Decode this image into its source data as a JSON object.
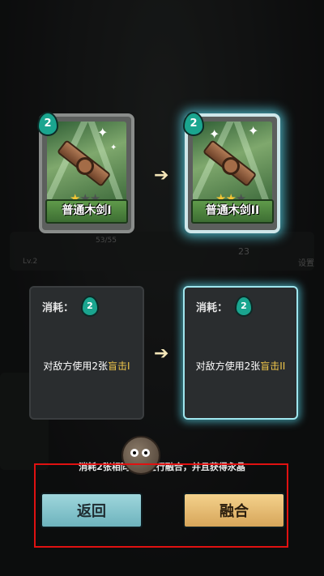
{
  "background": {
    "hp_text": "53/55",
    "level_text": "Lv.2",
    "gold": "23",
    "settings_label": "设置"
  },
  "cards": [
    {
      "cost": "2",
      "name": "普通木剑I",
      "stars": 1,
      "max_stars": 3
    },
    {
      "cost": "2",
      "name": "普通木剑II",
      "stars": 2,
      "max_stars": 3
    }
  ],
  "panels": [
    {
      "cost_label": "消耗：",
      "cost": "2",
      "desc_prefix": "对敌方使用2张",
      "desc_keyword": "盲击I"
    },
    {
      "cost_label": "消耗：",
      "cost": "2",
      "desc_prefix": "对敌方使用2张",
      "desc_keyword": "盲击II"
    }
  ],
  "hint": "消耗2张相同卡牌进行融合，并且获得永晶",
  "buttons": {
    "back": "返回",
    "fuse": "融合"
  },
  "colors": {
    "highlight": "#f2c84b",
    "glow": "#5adcf0",
    "frame": "#e01111"
  }
}
